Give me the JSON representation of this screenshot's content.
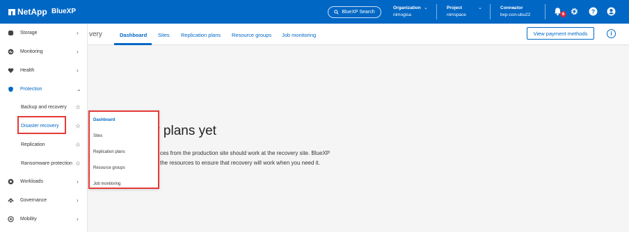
{
  "header": {
    "brand": "NetApp",
    "product": "BlueXP",
    "search_label": "BlueXP Search",
    "organization": {
      "label": "Organization",
      "value": "nimogisa"
    },
    "project": {
      "label": "Project",
      "value": "nimspace"
    },
    "connector": {
      "label": "Connector",
      "value": "bxp-con-ubu22"
    },
    "notification_count": "6"
  },
  "subnav": {
    "app_title": "very",
    "tabs": [
      {
        "label": "Dashboard",
        "active": true
      },
      {
        "label": "Sites"
      },
      {
        "label": "Replication plans"
      },
      {
        "label": "Resource groups"
      },
      {
        "label": "Job monitoring"
      }
    ],
    "view_payment_label": "View payment methods"
  },
  "sidebar": {
    "items": [
      {
        "label": "Storage",
        "icon": "storage-icon"
      },
      {
        "label": "Monitoring",
        "icon": "monitoring-icon"
      },
      {
        "label": "Health",
        "icon": "health-icon"
      },
      {
        "label": "Protection",
        "icon": "shield-icon"
      },
      {
        "label": "Workloads",
        "icon": "workloads-icon"
      },
      {
        "label": "Governance",
        "icon": "governance-icon"
      },
      {
        "label": "Mobility",
        "icon": "mobility-icon"
      }
    ],
    "protection_sub": [
      {
        "label": "Backup and recovery"
      },
      {
        "label": "Disaster recovery"
      },
      {
        "label": "Replication"
      },
      {
        "label": "Ransomware protection"
      }
    ]
  },
  "main": {
    "heading": "any plans yet",
    "desc_line1": "ces from the production site should work at the recovery site. BlueXP",
    "desc_line2": "the resources to ensure that recovery will work when you need it."
  },
  "flyout": {
    "items": [
      {
        "label": "Dashboard"
      },
      {
        "label": "Sites"
      },
      {
        "label": "Replication plans"
      },
      {
        "label": "Resource groups"
      },
      {
        "label": "Job monitoring"
      }
    ]
  },
  "colors": {
    "brand_blue": "#0067c5",
    "highlight_red": "#e53935"
  }
}
